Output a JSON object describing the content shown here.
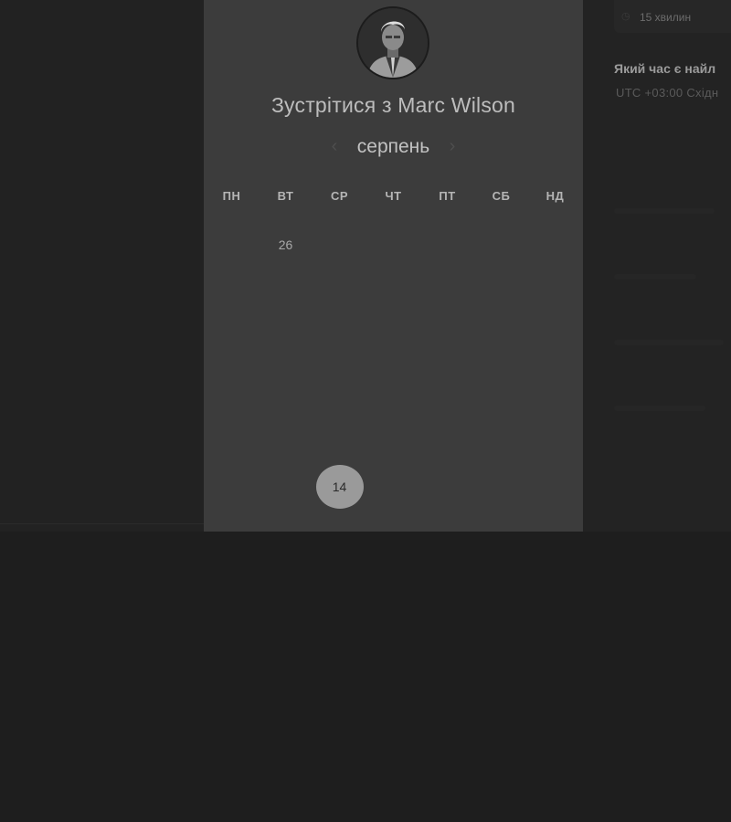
{
  "sidebar": {
    "duration": "15 хвилин",
    "timezone_question": "Який час є найл",
    "timezone_value": "UTC +03:00 Східн"
  },
  "scheduler": {
    "title": "Зустрітися з Marc Wilson",
    "month": "серпень",
    "prev_icon": "chevron-left-icon",
    "next_icon": "chevron-right-icon",
    "weekdays": [
      "ПН",
      "ВТ",
      "СР",
      "ЧТ",
      "ПТ",
      "СБ",
      "НД"
    ],
    "weeks": [
      [
        "",
        "26",
        "",
        "",
        "",
        "",
        ""
      ],
      [
        "",
        "",
        "",
        "",
        "",
        "",
        ""
      ],
      [
        "",
        "",
        "",
        "",
        "",
        "",
        ""
      ],
      [
        "",
        "",
        "",
        "",
        "",
        "",
        ""
      ],
      [
        "",
        "",
        "",
        "",
        "",
        "",
        ""
      ],
      [
        "",
        "",
        "14",
        "",
        "",
        "",
        ""
      ]
    ],
    "available_days": [
      "26"
    ],
    "selected_day": "14"
  },
  "colors": {
    "background": "#202020",
    "modal": "#3c3c3c",
    "selected_circle": "#9a9a9a"
  }
}
